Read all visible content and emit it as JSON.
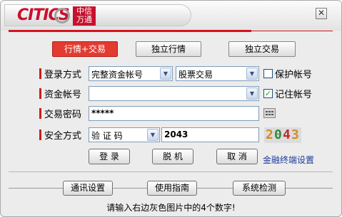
{
  "logo": {
    "brand": "CITICS",
    "box_line1": "中信",
    "box_line2": "万通"
  },
  "window": {
    "close_glyph": "✕"
  },
  "tabs": [
    "行情+交易",
    "独立行情",
    "独立交易"
  ],
  "form": {
    "login_label": "登录方式",
    "login_mode": "完整资金帐号",
    "market": "股票交易",
    "protect_label": "保护帐号",
    "protect_checked": false,
    "account_label": "资金帐号",
    "account_value": "",
    "remember_label": "记住帐号",
    "remember_checked": true,
    "password_label": "交易密码",
    "password_value": "*****",
    "security_label": "安全方式",
    "security_mode": "验 证 码",
    "captcha_input": "2043",
    "captcha_image_text": "2043"
  },
  "actions": {
    "login": "登 录",
    "offline": "脱 机",
    "cancel": "取 消",
    "terminal_link": "金融终端设置"
  },
  "bottom": {
    "comm": "通讯设置",
    "guide": "使用指南",
    "check": "系统检测"
  },
  "status": "请输入右边灰色图片中的4个数字!",
  "colors": {
    "brand_red": "#c8102e",
    "accent_red": "#d5131d",
    "tab_active": "#e33b2f",
    "link_blue": "#1a3a9c"
  }
}
